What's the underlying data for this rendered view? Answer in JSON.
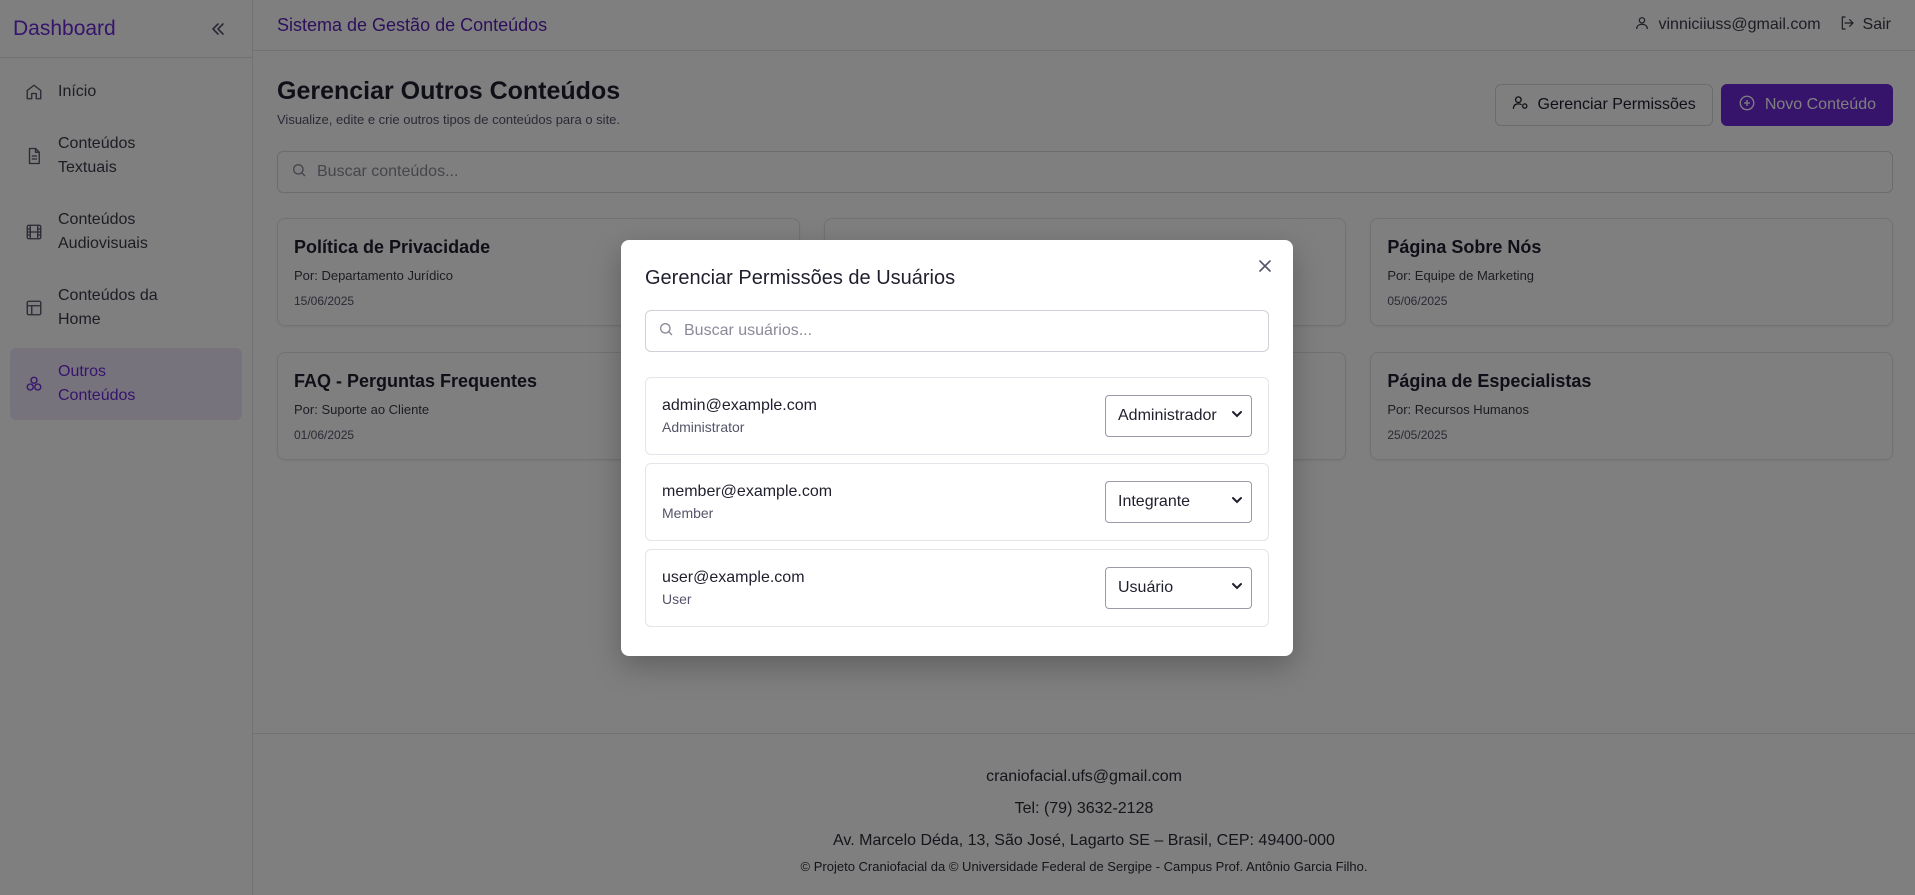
{
  "sidebar": {
    "brand": "Dashboard",
    "items": [
      {
        "label": "Início",
        "icon": "home-icon",
        "active": false
      },
      {
        "label": "Conteúdos Textuais",
        "icon": "file-text-icon",
        "active": false
      },
      {
        "label": "Conteúdos Audiovisuais",
        "icon": "film-icon",
        "active": false
      },
      {
        "label": "Conteúdos da Home",
        "icon": "layout-icon",
        "active": false
      },
      {
        "label": "Outros Conteúdos",
        "icon": "shapes-icon",
        "active": true
      }
    ]
  },
  "topbar": {
    "title": "Sistema de Gestão de Conteúdos",
    "user_email": "vinniciiuss@gmail.com",
    "logout_label": "Sair"
  },
  "main": {
    "title": "Gerenciar Outros Conteúdos",
    "subtitle": "Visualize, edite e crie outros tipos de conteúdos para o site.",
    "permissions_button": "Gerenciar Permissões",
    "new_button": "Novo Conteúdo",
    "search_placeholder": "Buscar conteúdos...",
    "cards": [
      {
        "title": "Política de Privacidade",
        "author": "Por: Departamento Jurídico",
        "date": "15/06/2025"
      },
      {
        "title": "",
        "author": "",
        "date": ""
      },
      {
        "title": "Página Sobre Nós",
        "author": "Por: Equipe de Marketing",
        "date": "05/06/2025"
      },
      {
        "title": "FAQ - Perguntas Frequentes",
        "author": "Por: Suporte ao Cliente",
        "date": "01/06/2025"
      },
      {
        "title": "",
        "author": "",
        "date": ""
      },
      {
        "title": "Página de Especialistas",
        "author": "Por: Recursos Humanos",
        "date": "25/05/2025"
      }
    ]
  },
  "footer": {
    "email": "craniofacial.ufs@gmail.com",
    "phone": "Tel: (79) 3632-2128",
    "address": "Av. Marcelo Déda, 13, São José, Lagarto SE – Brasil, CEP: 49400-000",
    "copyright": "© Projeto Craniofacial da © Universidade Federal de Sergipe - Campus Prof. Antônio Garcia Filho."
  },
  "modal": {
    "title": "Gerenciar Permissões de Usuários",
    "search_placeholder": "Buscar usuários...",
    "users": [
      {
        "email": "admin@example.com",
        "role": "Administrator",
        "selected": "Administrador"
      },
      {
        "email": "member@example.com",
        "role": "Member",
        "selected": "Integrante"
      },
      {
        "email": "user@example.com",
        "role": "User",
        "selected": "Usuário"
      }
    ]
  },
  "colors": {
    "accent": "#6d28d9",
    "overlay": "rgba(0,0,0,0.5)"
  }
}
